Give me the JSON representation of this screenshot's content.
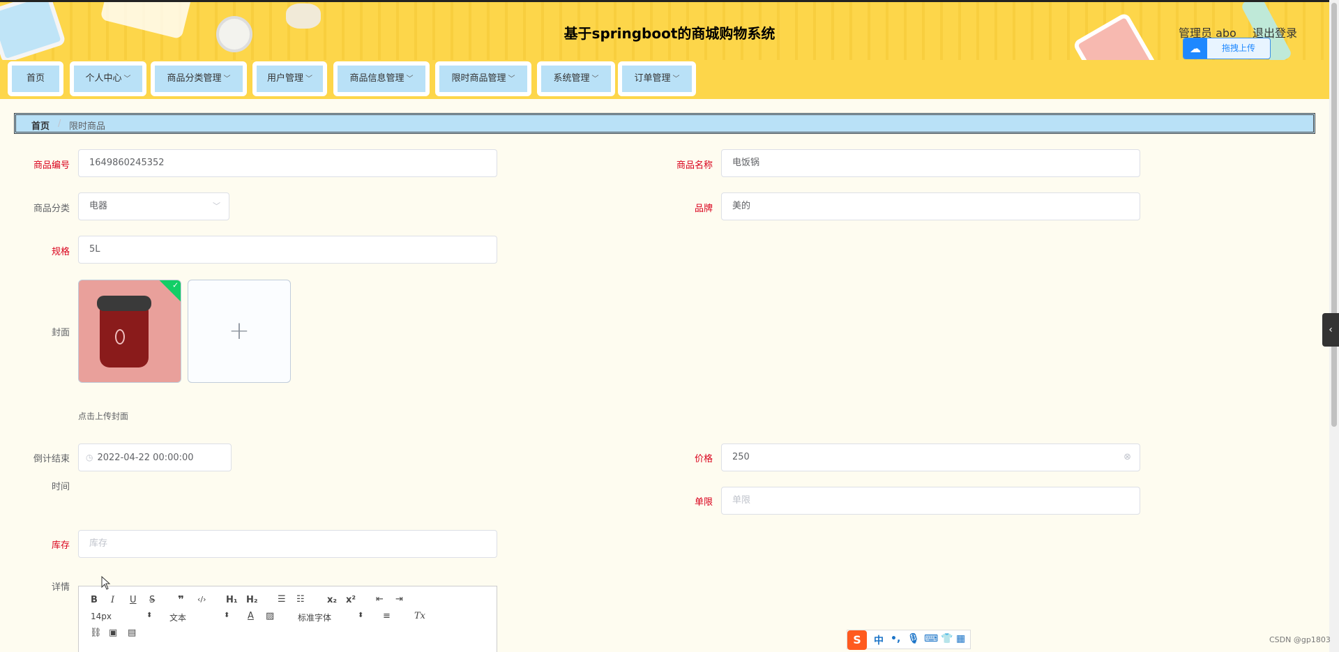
{
  "app": {
    "title": "基于springboot的商城购物系统",
    "user": "管理员 abo",
    "logout": "退出登录",
    "upload_widget": "拖拽上传"
  },
  "nav": [
    {
      "label": "首页",
      "dropdown": false
    },
    {
      "label": "个人中心",
      "dropdown": true
    },
    {
      "label": "商品分类管理",
      "dropdown": true
    },
    {
      "label": "用户管理",
      "dropdown": true
    },
    {
      "label": "商品信息管理",
      "dropdown": true
    },
    {
      "label": "限时商品管理",
      "dropdown": true
    },
    {
      "label": "系统管理",
      "dropdown": true
    },
    {
      "label": "订单管理",
      "dropdown": true
    }
  ],
  "breadcrumb": {
    "home": "首页",
    "separator": "/",
    "current": "限时商品"
  },
  "form": {
    "product_no": {
      "label": "商品编号",
      "value": "1649860245352"
    },
    "product_name": {
      "label": "商品名称",
      "value": "电饭锅"
    },
    "category": {
      "label": "商品分类",
      "value": "电器"
    },
    "brand": {
      "label": "品牌",
      "value": "美的"
    },
    "spec": {
      "label": "规格",
      "value": "5L"
    },
    "cover": {
      "label": "封面",
      "hint": "点击上传封面",
      "add_symbol": "+"
    },
    "countdown": {
      "label_line1": "倒计结束",
      "label_line2": "时间",
      "value": "2022-04-22 00:00:00"
    },
    "price": {
      "label": "价格",
      "value": "250"
    },
    "limit": {
      "label": "单限",
      "placeholder": "单限"
    },
    "stock": {
      "label": "库存",
      "placeholder": "库存"
    },
    "details": {
      "label": "详情"
    }
  },
  "editor": {
    "font_size": "14px",
    "text_type": "文本",
    "font_family": "标准字体",
    "buttons_row1": [
      "B",
      "I",
      "U",
      "S",
      "❞",
      "</>",
      "H1",
      "H2",
      "ol",
      "ul",
      "x₂",
      "x²",
      "outdent",
      "indent"
    ],
    "buttons_row2": [
      "A",
      "highlight",
      "align",
      "Tx"
    ],
    "buttons_row3": [
      "link",
      "image",
      "video"
    ]
  },
  "ime": {
    "logo": "S",
    "mode": "中"
  },
  "watermark": "CSDN @gp1803",
  "colors": {
    "header_bg": "#fdd64a",
    "nav_item_bg": "#b9e1f7",
    "page_bg": "#fefcf0",
    "required": "#d9001b"
  }
}
